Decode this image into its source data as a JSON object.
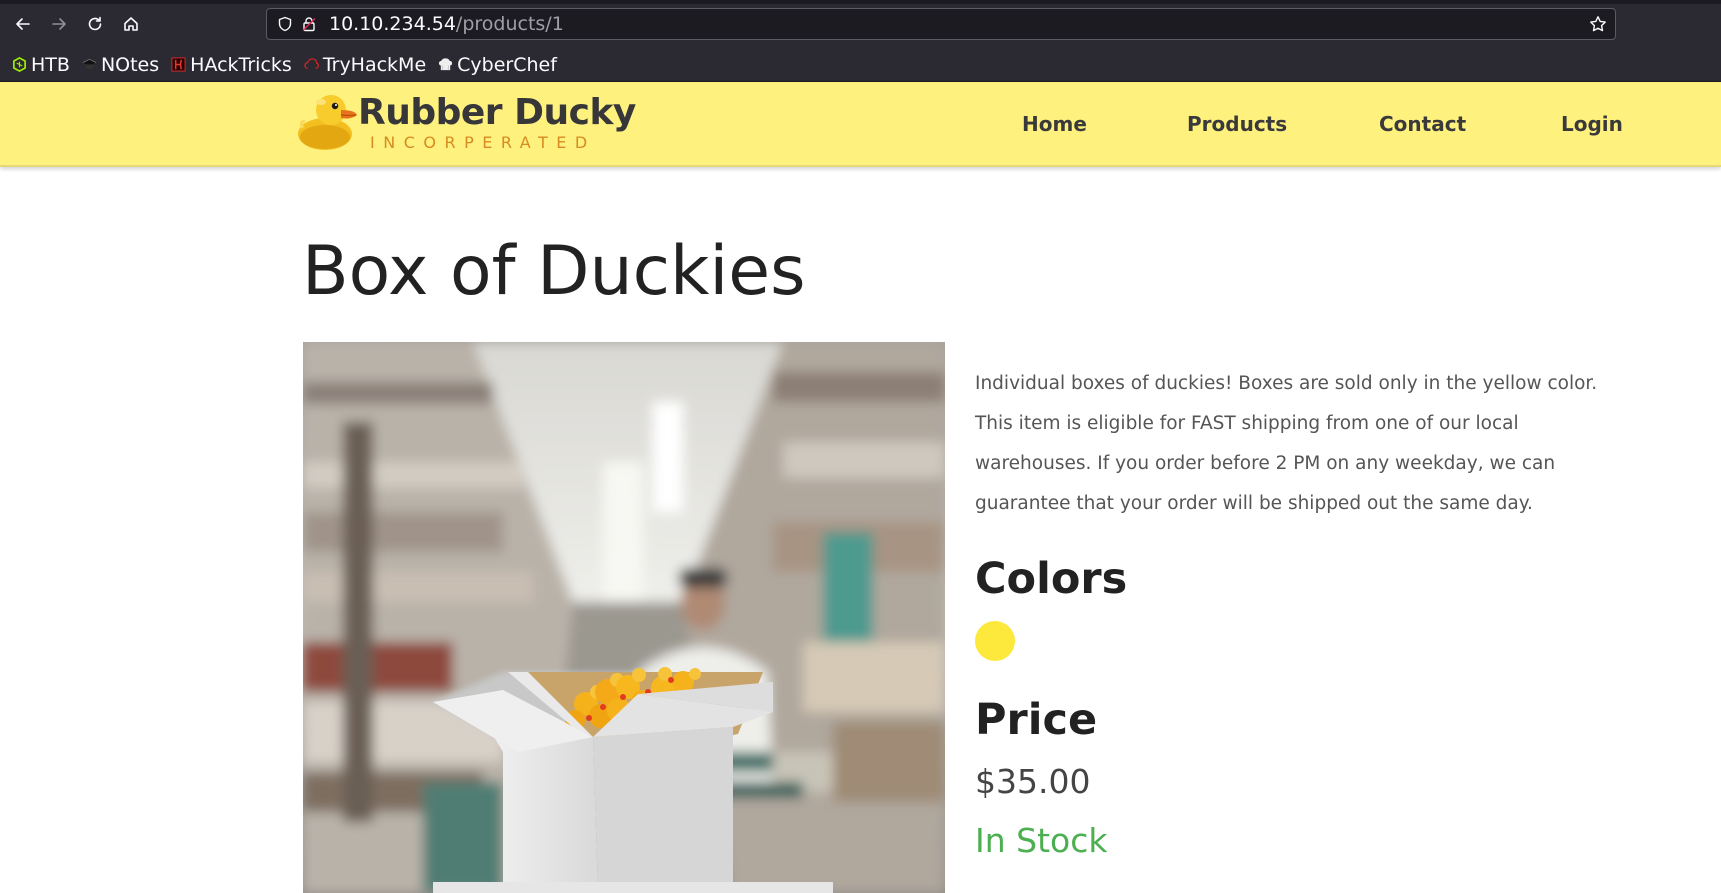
{
  "browser": {
    "url_host": "10.10.234.54",
    "url_path": "/products/1",
    "bookmarks": [
      {
        "label": "HTB",
        "icon": "htb-icon",
        "color": "#9fef00"
      },
      {
        "label": "NOtes",
        "icon": "notes-icon",
        "color": "#1c1c1c"
      },
      {
        "label": "HAckTricks",
        "icon": "hacktricks-icon",
        "color": "#d32f2f"
      },
      {
        "label": "TryHackMe",
        "icon": "tryhackme-icon",
        "color": "#c62828"
      },
      {
        "label": "CyberChef",
        "icon": "cyberchef-icon",
        "color": "#e0e0e0"
      }
    ]
  },
  "site": {
    "brand_name": "Rubber Ducky",
    "brand_sub": "INCORPERATED",
    "nav": [
      "Home",
      "Products",
      "Contact",
      "Login"
    ],
    "header_color": "#fef17e"
  },
  "product": {
    "title": "Box of Duckies",
    "description": "Individual boxes of duckies! Boxes are sold only in the yellow color. This item is eligible for FAST shipping from one of our local warehouses. If you order before 2 PM on any weekday, we can guarantee that your order will be shipped out the same day.",
    "colors_heading": "Colors",
    "colors": [
      "#fde93b"
    ],
    "price_heading": "Price",
    "price": "$35.00",
    "stock_status": "In Stock",
    "stock_color": "#4caf50"
  }
}
